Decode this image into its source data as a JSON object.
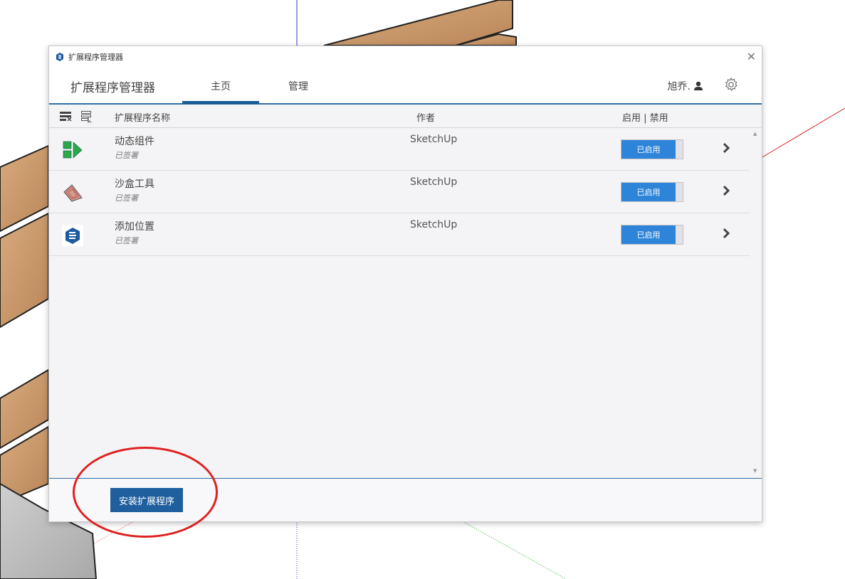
{
  "window": {
    "title": "扩展程序管理器",
    "close_icon": "close-icon"
  },
  "header": {
    "app_title": "扩展程序管理器",
    "tabs": [
      {
        "label": "主页",
        "active": true
      },
      {
        "label": "管理",
        "active": false
      }
    ],
    "user": "旭乔.",
    "user_icon": "person-icon",
    "settings_icon": "gear-icon"
  },
  "columns": {
    "name": "扩展程序名称",
    "author": "作者",
    "toggle": "启用 | 禁用"
  },
  "extensions": [
    {
      "name": "动态组件",
      "status": "已签署",
      "author": "SketchUp",
      "state": "已启用",
      "icon": "dynamic-components-icon"
    },
    {
      "name": "沙盒工具",
      "status": "已签署",
      "author": "SketchUp",
      "state": "已启用",
      "icon": "sandbox-tools-icon"
    },
    {
      "name": "添加位置",
      "status": "已签署",
      "author": "SketchUp",
      "state": "已启用",
      "icon": "sketchup-logo-icon"
    }
  ],
  "footer": {
    "install_label": "安装扩展程序"
  },
  "colors": {
    "accent": "#1f5f9e",
    "toggle_on": "#2d84d8",
    "highlight": "#e02020"
  }
}
